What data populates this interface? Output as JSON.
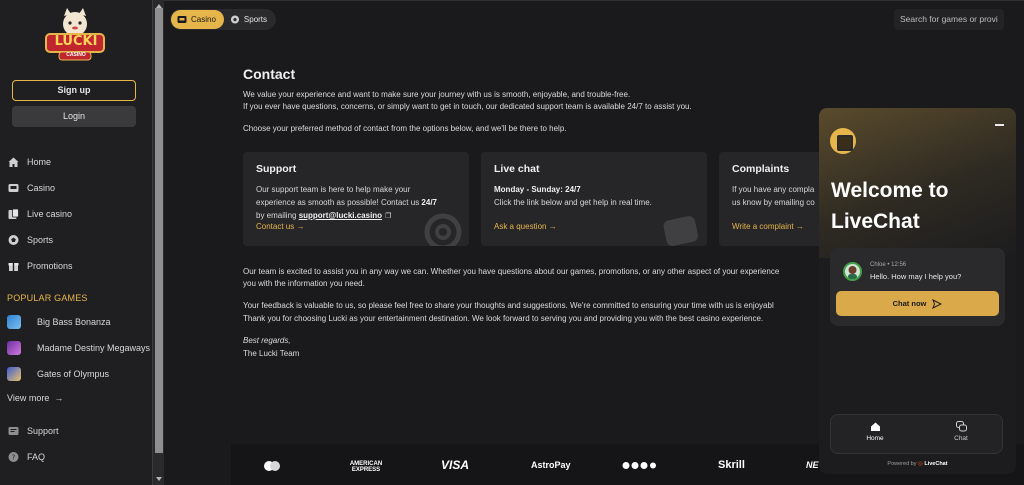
{
  "brand": {
    "logo_text": "LUCKI",
    "logo_sub": "CASINO",
    "accent": "#e7b64b"
  },
  "auth": {
    "signup_label": "Sign up",
    "login_label": "Login"
  },
  "sidebar": {
    "nav": [
      {
        "label": "Home",
        "icon": "home-icon"
      },
      {
        "label": "Casino",
        "icon": "casino-icon"
      },
      {
        "label": "Live casino",
        "icon": "live-casino-icon"
      },
      {
        "label": "Sports",
        "icon": "sports-icon"
      },
      {
        "label": "Promotions",
        "icon": "gift-icon"
      }
    ],
    "popular_title": "POPULAR GAMES",
    "games": [
      {
        "label": "Big Bass Bonanza"
      },
      {
        "label": "Madame Destiny Megaways"
      },
      {
        "label": "Gates of Olympus"
      }
    ],
    "view_more": "View more",
    "bottom": [
      {
        "label": "Support",
        "icon": "support-icon"
      },
      {
        "label": "FAQ",
        "icon": "question-icon"
      }
    ]
  },
  "topbar": {
    "tabs": [
      {
        "label": "Casino",
        "active": true
      },
      {
        "label": "Sports",
        "active": false
      }
    ],
    "search_placeholder": "Search for games or provi"
  },
  "page": {
    "title": "Contact",
    "intro_1": "We value your experience and want to make sure your journey with us is smooth, enjoyable, and trouble-free.",
    "intro_2": "If you ever have questions, concerns, or simply want to get in touch, our dedicated support team is available 24/7 to assist you.",
    "intro_3": "Choose your preferred method of contact from the options below, and we'll be there to help.",
    "cards": [
      {
        "title": "Support",
        "line_1": "Our support team is here to help make your",
        "line_2a": "experience as smooth as possible! Contact us ",
        "line_2b": "24/7",
        "line_3a": "by emailing ",
        "line_3b": "support@lucki.casino",
        "link": "Contact us"
      },
      {
        "title": "Live chat",
        "line_1": "Monday - Sunday: 24/7",
        "line_2": "Click the link below and get help in real time.",
        "link": "Ask a question"
      },
      {
        "title": "Complaints",
        "line_1": "If you have any compla",
        "line_2": "us know by emailing co",
        "link": "Write a complaint"
      }
    ],
    "body_1": "Our team is excited to assist you in any way we can. Whether you have questions about our games, promotions, or any other aspect of your experience",
    "body_2": "you with the information you need.",
    "body_3": "Your feedback is valuable to us, so please feel free to share your thoughts and suggestions. We're committed to ensuring your time with us is enjoyabl",
    "body_4": "Thank you for choosing Lucki as your entertainment destination. We look forward to serving you and providing you with the best casino experience.",
    "sign_1": "Best regards,",
    "sign_2": "The Lucki Team"
  },
  "payments": [
    "AMERICAN EXPRESS",
    "VISA",
    "AstroPay",
    "Skrill",
    "NE"
  ],
  "livechat": {
    "title": "Welcome to LiveChat",
    "agent_meta": "Chloe • 12:56",
    "message": "Hello. How may I help you?",
    "cta": "Chat now",
    "nav_home": "Home",
    "nav_chat": "Chat",
    "powered_prefix": "Powered by ",
    "powered_brand": "LiveChat"
  }
}
